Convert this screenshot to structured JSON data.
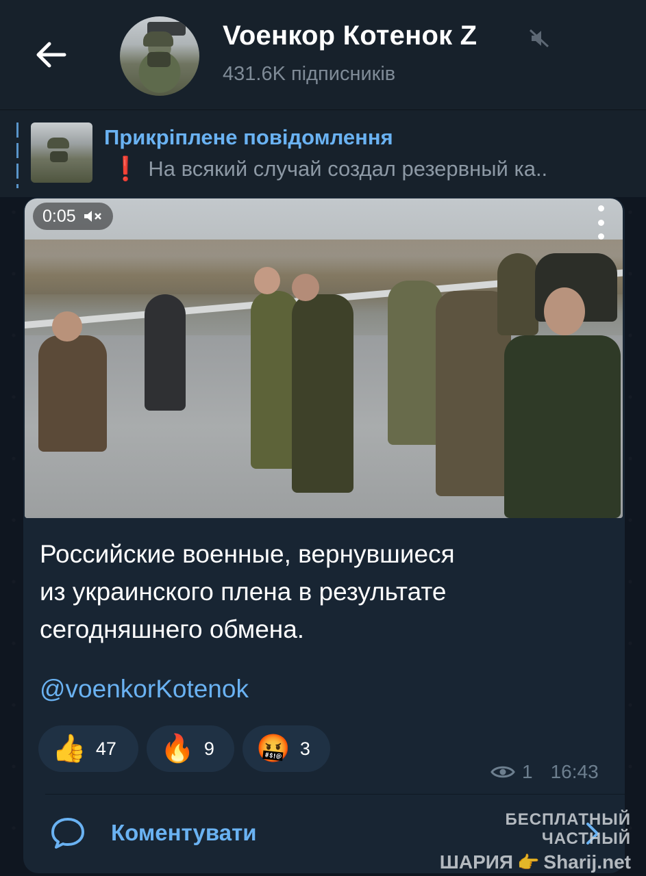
{
  "header": {
    "title": "Voенкор Котенок Z",
    "subscribers": "431.6K підписників"
  },
  "pinned": {
    "label": "Прикріплене повідомлення",
    "preview": "На всякий случай создал резервный ка..",
    "marker": "❗"
  },
  "message": {
    "video": {
      "duration": "0:05",
      "muted_icon": "volume-mute-icon"
    },
    "text_lines": [
      "Российские военные, вернувшиеся",
      "из украинского плена в результате",
      "сегодняшнего обмена."
    ],
    "mention": "@voenkorKotenok",
    "reactions": [
      {
        "emoji": "👍",
        "count": "47"
      },
      {
        "emoji": "🔥",
        "count": "9"
      },
      {
        "emoji": "🤬",
        "count": "3"
      }
    ],
    "views": "1",
    "time": "16:43"
  },
  "comments": {
    "label": "Коментувати"
  },
  "watermark": {
    "line1": "БЕСПЛАТНЫЙ ЧАСТНЫЙ",
    "line2_left": "ШАРИЯ",
    "line2_hand": "👉",
    "line2_right": "Sharij.net"
  },
  "colors": {
    "accent": "#6ab2f2",
    "header_bg": "#17212b",
    "bubble_bg": "#182533",
    "reaction_bg": "#1f3144",
    "alert": "#e23b3b"
  }
}
